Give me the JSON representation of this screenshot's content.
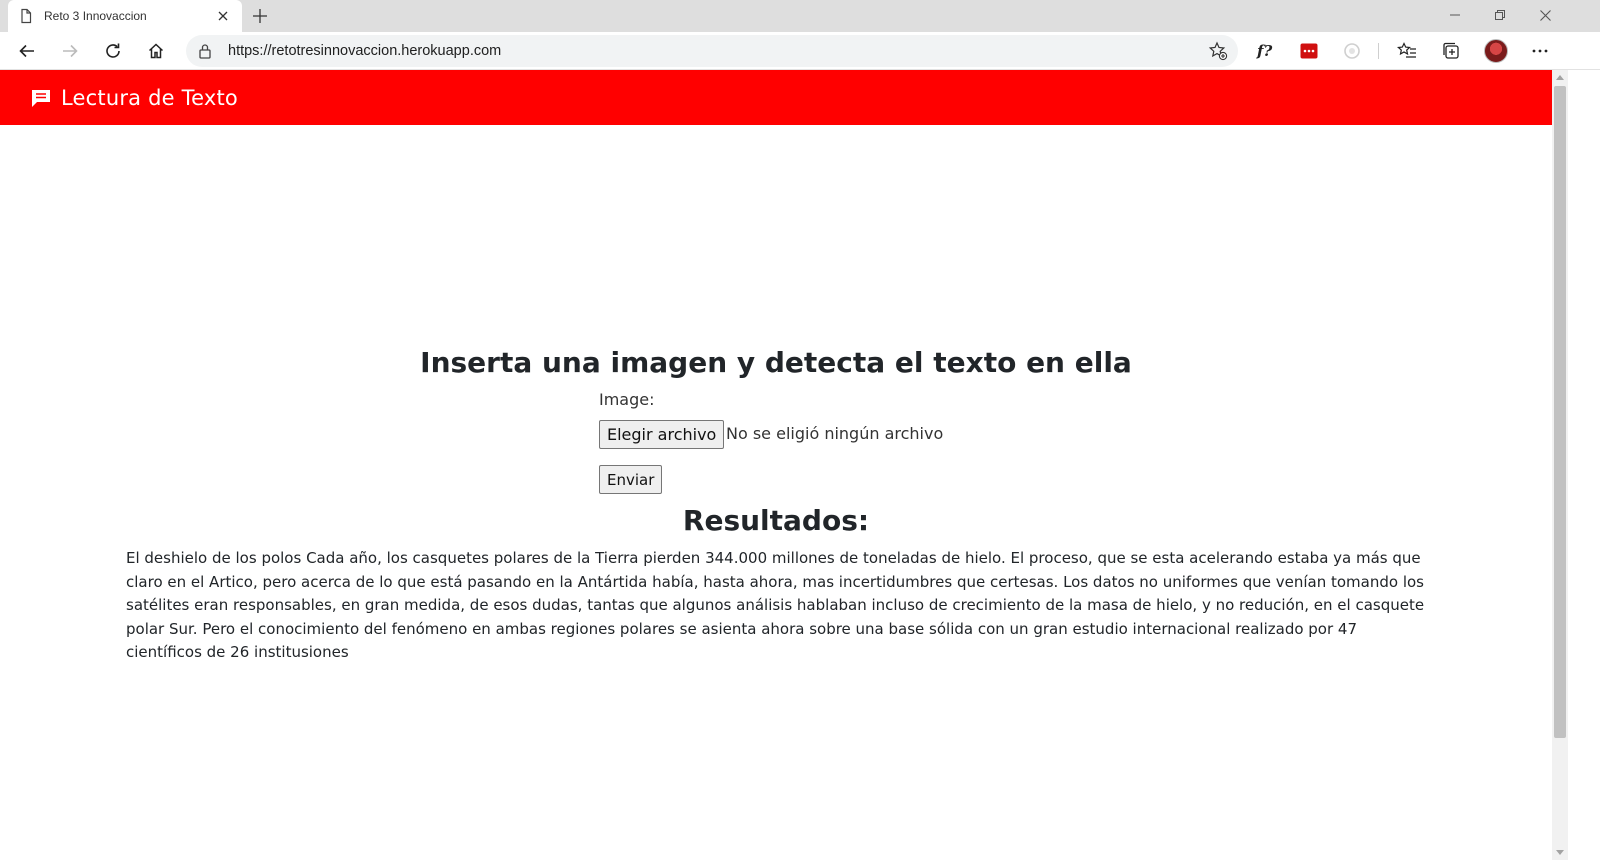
{
  "browser": {
    "tab_title": "Reto 3 Innovaccion",
    "url": "https://retotresinnovaccion.herokuapp.com"
  },
  "navbar": {
    "brand": "Lectura de Texto",
    "color": "#ff0000"
  },
  "main": {
    "heading": "Inserta una imagen y detecta el texto en ella",
    "image_label": "Image:",
    "file_button_label": "Elegir archivo",
    "file_status": "No se eligió ningún archivo",
    "submit_label": "Enviar",
    "results_heading": "Resultados:",
    "results_text": "El deshielo de los polos Cada año, los casquetes polares de la Tierra pierden 344.000 millones de toneladas de hielo. El proceso, que se esta acelerando estaba ya más que claro en el Artico, pero acerca de lo que está pasando en la Antártida había, hasta ahora, mas incertidumbres que certesas. Los datos no uniformes que venían tomando los satélites eran responsables, en gran medida, de esos dudas, tantas que algunos análisis hablaban incluso de crecimiento de la masa de hielo, y no redución, en el casquete polar Sur. Pero el conocimiento del fenómeno en ambas regiones polares se asienta ahora sobre una base sólida con un gran estudio internacional realizado por 47 científicos de 26 institusiones"
  },
  "icons": {
    "tab": "page-icon",
    "brand": "chat-icon",
    "toolbar": [
      "back-icon",
      "forward-icon",
      "refresh-icon",
      "home-icon",
      "lock-icon",
      "add-favorite-icon",
      "font-extension-icon",
      "red-extension-icon",
      "circle-extension-icon",
      "favorites-icon",
      "collections-icon",
      "more-icon"
    ]
  }
}
